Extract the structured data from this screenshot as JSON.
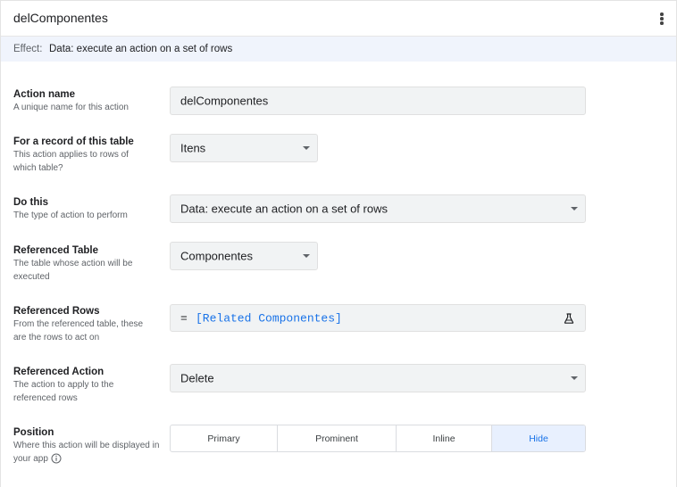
{
  "header": {
    "title": "delComponentes",
    "menu_icon": "more-vertical-icon"
  },
  "effect": {
    "label": "Effect:",
    "value": "Data: execute an action on a set of rows"
  },
  "fields": {
    "action_name": {
      "title": "Action name",
      "subtitle": "A unique name for this action",
      "value": "delComponentes"
    },
    "for_record": {
      "title": "For a record of this table",
      "subtitle": "This action applies to rows of which table?",
      "value": "Itens"
    },
    "do_this": {
      "title": "Do this",
      "subtitle": "The type of action to perform",
      "value": "Data: execute an action on a set of rows"
    },
    "referenced_table": {
      "title": "Referenced Table",
      "subtitle": "The table whose action will be executed",
      "value": "Componentes"
    },
    "referenced_rows": {
      "title": "Referenced Rows",
      "subtitle": "From the referenced table, these are the rows to act on",
      "eq": "=",
      "expression": "[Related Componentes]",
      "icon": "flask-icon"
    },
    "referenced_action": {
      "title": "Referenced Action",
      "subtitle": "The action to apply to the referenced rows",
      "value": "Delete"
    },
    "position": {
      "title": "Position",
      "subtitle": "Where this action will be displayed in your app",
      "info_icon": "info-icon",
      "options": [
        "Primary",
        "Prominent",
        "Inline",
        "Hide"
      ],
      "selected": "Hide"
    }
  },
  "colors": {
    "accent": "#1a73e8",
    "selected_bg": "#e8f0fe",
    "input_bg": "#f1f3f4",
    "effect_bg": "#f0f4fc"
  }
}
